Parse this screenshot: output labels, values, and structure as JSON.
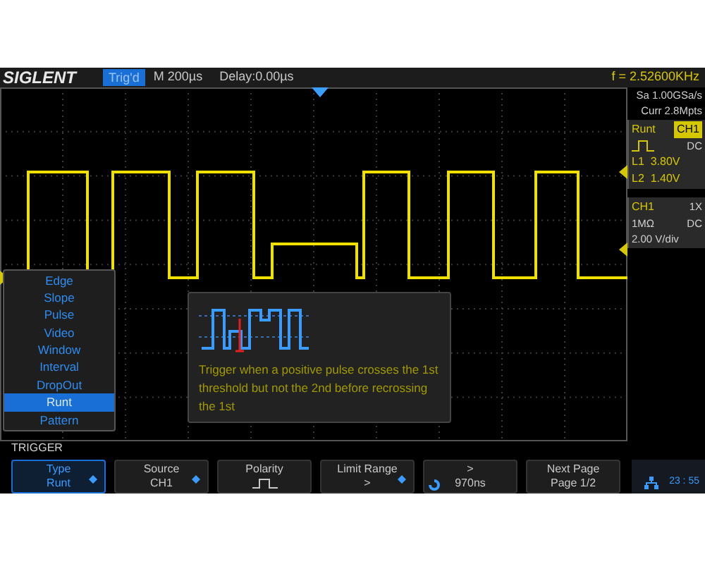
{
  "top_bar": {
    "brand": "SIGLENT",
    "trigger_status": "Trig'd",
    "timebase": "M 200µs",
    "delay": "Delay:0.00µs",
    "frequency": "f = 2.52600KHz"
  },
  "acquisition": {
    "sample_rate": "Sa 1.00GSa/s",
    "memory_depth": "Curr 2.8Mpts"
  },
  "trigger_panel": {
    "type": "Runt",
    "source": "CH1",
    "coupling": "DC",
    "level_1": "L1  3.80V",
    "level_2": "L2  1.40V"
  },
  "channel_panel": {
    "name": "CH1",
    "probe": "1X",
    "impedance": "1MΩ",
    "coupling": "DC",
    "scale": "2.00 V/div"
  },
  "type_menu": [
    {
      "label": "Edge",
      "selected": false
    },
    {
      "label": "Slope",
      "selected": false
    },
    {
      "label": "Pulse",
      "selected": false
    },
    {
      "label": "Video",
      "selected": false
    },
    {
      "label": "Window",
      "selected": false
    },
    {
      "label": "Interval",
      "selected": false
    },
    {
      "label": "DropOut",
      "selected": false
    },
    {
      "label": "Runt",
      "selected": true
    },
    {
      "label": "Pattern",
      "selected": false
    }
  ],
  "info_box": {
    "text": "Trigger when a positive pulse crosses the 1st threshold but not the 2nd before recrossing the 1st"
  },
  "menu_title": "TRIGGER",
  "softkeys": [
    {
      "kind": "text",
      "label": "Type",
      "value": "Runt",
      "selected": true,
      "has_arrow": true,
      "knob": false
    },
    {
      "kind": "text",
      "label": "Source",
      "value": "CH1",
      "selected": false,
      "has_arrow": true,
      "knob": false
    },
    {
      "kind": "pulse",
      "label": "Polarity",
      "selected": false,
      "has_arrow": false,
      "knob": false
    },
    {
      "kind": "text",
      "label": "Limit Range",
      "value": ">",
      "selected": false,
      "has_arrow": true,
      "knob": false
    },
    {
      "kind": "text",
      "label": ">",
      "value": "970ns",
      "selected": false,
      "has_arrow": false,
      "knob": true
    },
    {
      "kind": "text",
      "label": "Next Page",
      "value": "Page 1/2",
      "selected": false,
      "has_arrow": false,
      "knob": false
    }
  ],
  "clock": "23 : 55"
}
